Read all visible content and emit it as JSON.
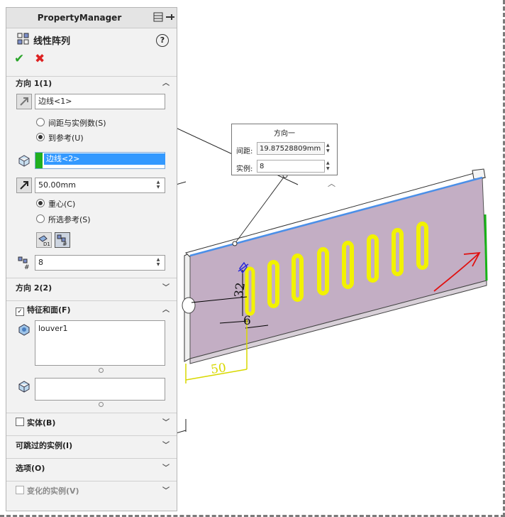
{
  "property_manager": {
    "title": "PropertyManager",
    "feature_title": "线性阵列",
    "help": "?",
    "ok": "✔",
    "cancel": "✖",
    "direction1": {
      "header": "方向 1(1)",
      "edge_value": "边线<1>",
      "option_spacing": "间距与实例数(S)",
      "option_up_to_ref": "到参考(U)",
      "reference_value": "边线<2>",
      "offset_value": "50.00mm",
      "option_centroid": "重心(C)",
      "option_selected_ref": "所选参考(S)",
      "instances_value": "8"
    },
    "direction2": {
      "header": "方向 2(2)"
    },
    "features_faces": {
      "header": "特征和面(F)",
      "checked": true,
      "items": [
        "louver1"
      ]
    },
    "bodies": {
      "header": "实体(B)",
      "checked": false
    },
    "instances_to_skip": {
      "header": "可跳过的实例(I)"
    },
    "options": {
      "header": "选项(O)"
    },
    "instances_to_vary": {
      "header": "变化的实例(V)",
      "checked": false
    }
  },
  "callout": {
    "title": "方向一",
    "spacing_label": "间距:",
    "spacing_value": "19.87528809mm",
    "instances_label": "实例:",
    "instances_value": "8"
  },
  "canvas": {
    "dim_height": "32",
    "dim_width": "6",
    "dim_offset": "50"
  },
  "colors": {
    "annotation_red": "#e01010",
    "louver_yellow": "#f2f200",
    "panel_face": "#c3aec4",
    "selection_blue": "#3399ff",
    "edge_blue": "#4a8fe8",
    "edge_green": "#18b418"
  },
  "icons": [
    "linear-pattern-icon",
    "pin-icon",
    "help-icon",
    "ok-icon",
    "cancel-icon",
    "edge-direction-icon",
    "reference-icon",
    "offset-direction-icon",
    "centroid-icon",
    "selected-ref-icon",
    "instances-icon",
    "feature-icon",
    "body-icon"
  ]
}
